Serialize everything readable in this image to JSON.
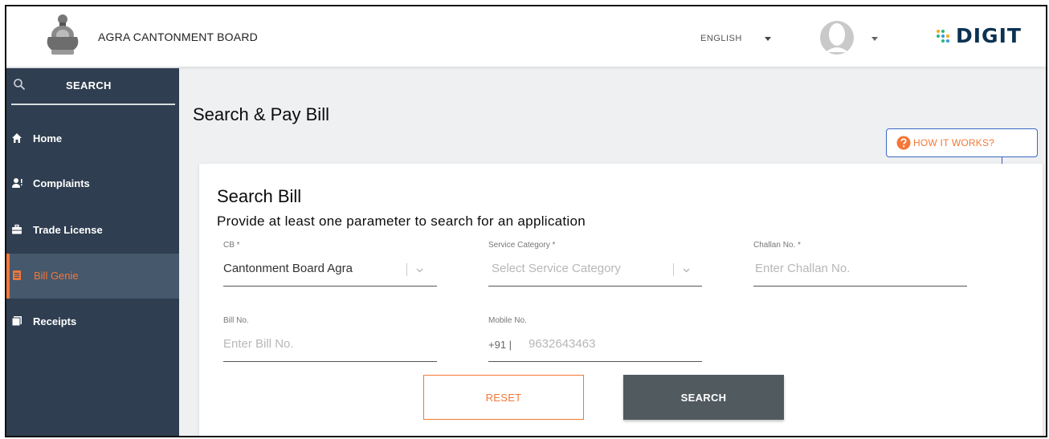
{
  "header": {
    "org_name": "AGRA CANTONMENT BOARD",
    "language": "ENGLISH",
    "brand": "DIGIT"
  },
  "sidebar": {
    "search_label": "SEARCH",
    "items": [
      {
        "label": "Home",
        "icon": "home-icon"
      },
      {
        "label": "Complaints",
        "icon": "complaints-icon"
      },
      {
        "label": "Trade License",
        "icon": "briefcase-icon"
      },
      {
        "label": "Bill Genie",
        "icon": "bill-icon",
        "active": true
      },
      {
        "label": "Receipts",
        "icon": "receipts-icon"
      }
    ]
  },
  "main": {
    "page_title": "Search & Pay Bill",
    "how_it_works": "HOW IT WORKS?"
  },
  "form": {
    "title": "Search Bill",
    "subtitle": "Provide at least one parameter to search for an application",
    "cb": {
      "label": "CB *",
      "value": "Cantonment Board Agra"
    },
    "service_category": {
      "label": "Service Category *",
      "placeholder": "Select Service Category"
    },
    "challan": {
      "label": "Challan No. *",
      "placeholder": "Enter Challan No."
    },
    "bill_no": {
      "label": "Bill No.",
      "placeholder": "Enter Bill No."
    },
    "mobile": {
      "label": "Mobile No.",
      "prefix": "+91 |",
      "value": "9632643463"
    },
    "reset_label": "RESET",
    "search_label": "SEARCH"
  },
  "colors": {
    "accent": "#f47738",
    "sidebar_bg": "#2f3e50",
    "sidebar_active": "#45586c",
    "search_button": "#505a5f",
    "callout": "#3a68c4"
  }
}
